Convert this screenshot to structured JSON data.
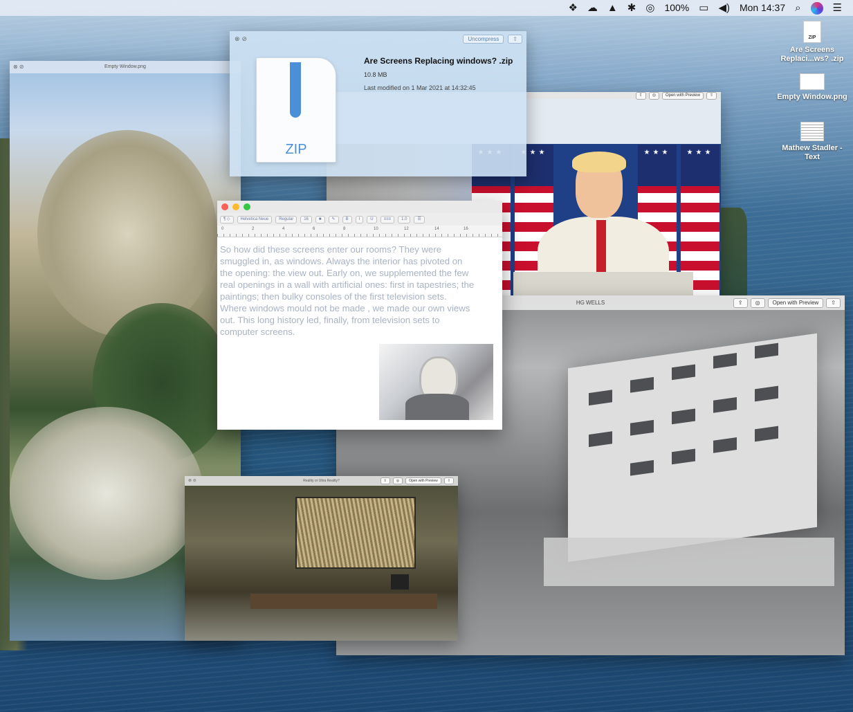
{
  "menubar": {
    "icons": [
      "dropbox-icon",
      "creative-cloud-icon",
      "drive-icon",
      "bluetooth-icon",
      "mirroring-icon",
      "battery-icon",
      "volume-icon",
      "search-icon",
      "siri-icon",
      "menu-list-icon"
    ],
    "battery_percent": "100%",
    "clock": "Mon 14:37"
  },
  "desktop_icons": [
    {
      "label": "Are Screens Replaci...ws? .zip",
      "badge": "ZIP"
    },
    {
      "label": "Empty Window.png"
    },
    {
      "label": "Mathew Stadler - Text"
    }
  ],
  "empty_window": {
    "title": "Empty Window.png"
  },
  "zip_window": {
    "uncompress_label": "Uncompress",
    "file_name": "Are Screens Replacing windows? .zip",
    "file_size": "10.8 MB",
    "modified": "Last modified on 1 Mar 2021 at 14:32:45",
    "icon_label": "ZIP"
  },
  "press_window": {
    "open_with_label": "Open with Preview"
  },
  "textedit": {
    "font_family": "Helvetica Neue",
    "font_style": "Regular",
    "font_size": "16",
    "line_spacing": "1.0",
    "ruler_numbers": [
      "0",
      "2",
      "4",
      "6",
      "8",
      "10",
      "12",
      "14",
      "16"
    ],
    "bold": "B",
    "italic": "I",
    "underline": "U",
    "lines": [
      "So how did these screens enter our rooms? They were",
      "smuggled in, as windows. Always the interior has pivoted on",
      "the opening: the view out. Early on, we supplemented the few",
      "real openings in a wall with artificial ones: first in tapestries; the",
      "paintings;  then bulky consoles of the first television sets.",
      "Where windows mould not be made , we made our own views",
      "out. This long history led, finally, from television sets to",
      "computer screens."
    ]
  },
  "wells_window": {
    "title": "HG WELLS",
    "open_with_label": "Open with Preview"
  },
  "reality_window": {
    "title": "Reality or Ultra Reality?",
    "open_with_label": "Open with Preview"
  },
  "colors": {
    "accent_blue": "#4a8fd8",
    "flag_red": "#c8102e",
    "flag_blue": "#1d2f6e"
  }
}
